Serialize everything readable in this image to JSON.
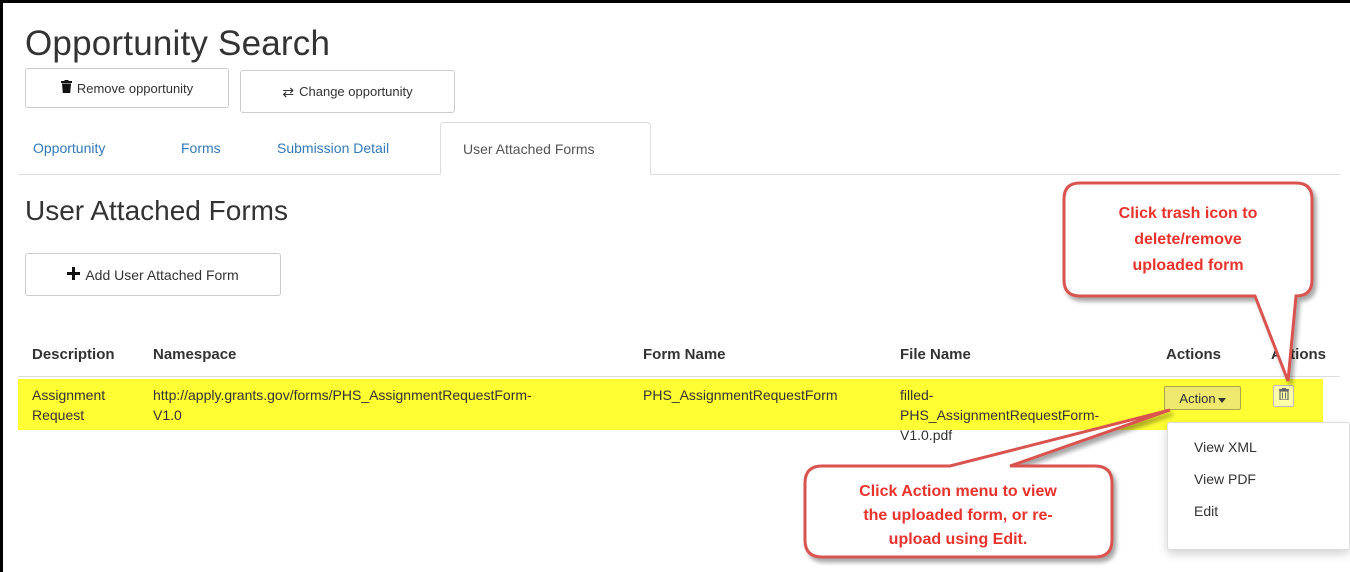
{
  "page": {
    "title": "Opportunity Search"
  },
  "toolbar": {
    "remove_label": "Remove opportunity",
    "change_label": "Change opportunity"
  },
  "tabs": [
    {
      "label": "Opportunity",
      "active": false
    },
    {
      "label": "Forms",
      "active": false
    },
    {
      "label": "Submission Detail",
      "active": false
    },
    {
      "label": "User Attached Forms",
      "active": true
    }
  ],
  "section": {
    "title": "User Attached Forms",
    "add_label": "Add User Attached Form"
  },
  "table": {
    "columns": [
      "Description",
      "Namespace",
      "Form Name",
      "File Name",
      "Actions",
      "Actions"
    ],
    "row": {
      "description_1": "Assignment",
      "description_2": "Request",
      "namespace_1": "http://apply.grants.gov/forms/PHS_AssignmentRequestForm-",
      "namespace_2": "V1.0",
      "form_name": "PHS_AssignmentRequestForm",
      "file_name_1": "filled-",
      "file_name_2": "PHS_AssignmentRequestForm-",
      "file_name_3": "V1.0.pdf",
      "action_label": "Action"
    }
  },
  "action_menu": {
    "items": [
      "View XML",
      "View PDF",
      "Edit"
    ]
  },
  "callouts": {
    "trash": [
      "Click trash icon to",
      "delete/remove",
      "uploaded form"
    ],
    "action": [
      "Click Action menu to view",
      "the uploaded form, or re-",
      "upload using Edit."
    ]
  },
  "colors": {
    "link": "#337ab7",
    "highlight": "#ffff33",
    "callout_text": "#e8332d",
    "callout_fill": "#ffffff",
    "callout_border": "#d9534f"
  },
  "icons": {
    "remove": "trash-icon",
    "change": "swap-arrows-icon",
    "add": "plus-icon",
    "row_delete": "trash-icon",
    "dropdown": "caret-down-icon"
  }
}
